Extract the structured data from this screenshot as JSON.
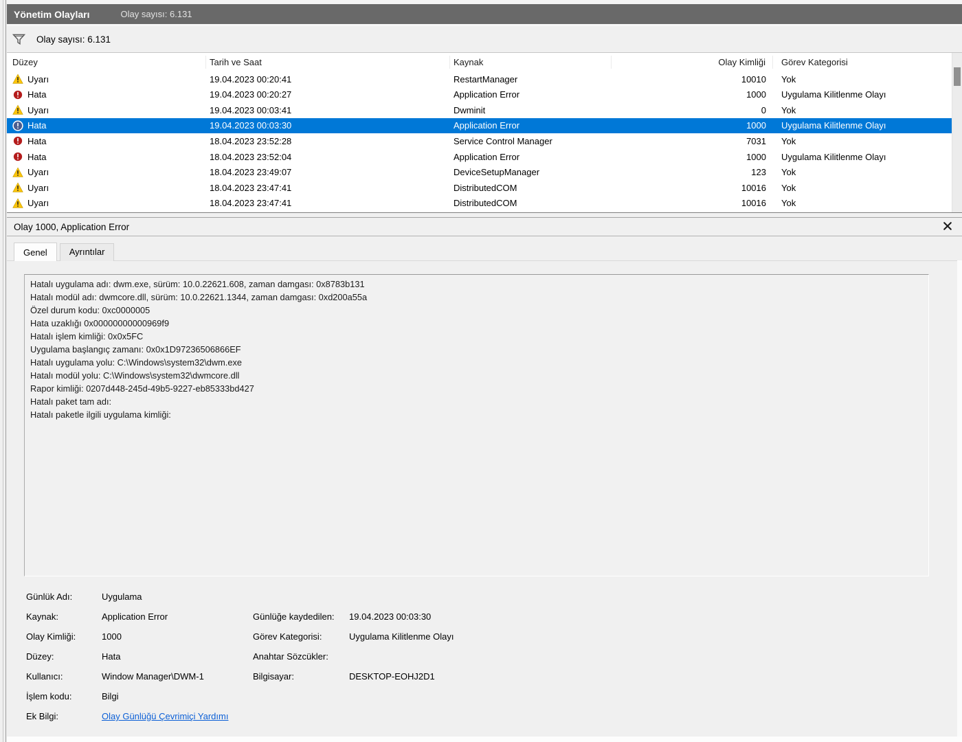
{
  "colors": {
    "accent": "#0078d7",
    "titlebar_bg": "#696969",
    "warning_icon": "#fdc50b",
    "error_icon": "#b41c1c",
    "selected_error_icon": "#4a5d8f",
    "link": "#0b5fd6"
  },
  "window": {
    "title": "Yönetim Olayları",
    "event_count": "Olay sayısı: 6.131"
  },
  "filter": {
    "icon": "filter-funnel-icon",
    "label": "Olay sayısı: 6.131"
  },
  "table": {
    "columns": {
      "level": "Düzey",
      "datetime": "Tarih ve Saat",
      "source": "Kaynak",
      "event_id": "Olay Kimliği",
      "category": "Görev Kategorisi"
    },
    "rows": [
      {
        "icon": "warning-icon",
        "level": "Uyarı",
        "datetime": "19.04.2023 00:20:41",
        "source": "RestartManager",
        "event_id": "10010",
        "category": "Yok",
        "selected": false
      },
      {
        "icon": "error-icon",
        "level": "Hata",
        "datetime": "19.04.2023 00:20:27",
        "source": "Application Error",
        "event_id": "1000",
        "category": "Uygulama Kilitlenme Olayı",
        "selected": false
      },
      {
        "icon": "warning-icon",
        "level": "Uyarı",
        "datetime": "19.04.2023 00:03:41",
        "source": "Dwminit",
        "event_id": "0",
        "category": "Yok",
        "selected": false
      },
      {
        "icon": "error-icon",
        "level": "Hata",
        "datetime": "19.04.2023 00:03:30",
        "source": "Application Error",
        "event_id": "1000",
        "category": "Uygulama Kilitlenme Olayı",
        "selected": true
      },
      {
        "icon": "error-icon",
        "level": "Hata",
        "datetime": "18.04.2023 23:52:28",
        "source": "Service Control Manager",
        "event_id": "7031",
        "category": "Yok",
        "selected": false
      },
      {
        "icon": "error-icon",
        "level": "Hata",
        "datetime": "18.04.2023 23:52:04",
        "source": "Application Error",
        "event_id": "1000",
        "category": "Uygulama Kilitlenme Olayı",
        "selected": false
      },
      {
        "icon": "warning-icon",
        "level": "Uyarı",
        "datetime": "18.04.2023 23:49:07",
        "source": "DeviceSetupManager",
        "event_id": "123",
        "category": "Yok",
        "selected": false
      },
      {
        "icon": "warning-icon",
        "level": "Uyarı",
        "datetime": "18.04.2023 23:47:41",
        "source": "DistributedCOM",
        "event_id": "10016",
        "category": "Yok",
        "selected": false
      },
      {
        "icon": "warning-icon",
        "level": "Uyarı",
        "datetime": "18.04.2023 23:47:41",
        "source": "DistributedCOM",
        "event_id": "10016",
        "category": "Yok",
        "selected": false
      }
    ]
  },
  "detail": {
    "title": "Olay 1000, Application Error",
    "close_icon": "close-icon",
    "tabs": [
      {
        "label": "Genel",
        "active": true
      },
      {
        "label": "Ayrıntılar",
        "active": false
      }
    ],
    "description_lines": [
      "Hatalı uygulama adı: dwm.exe, sürüm: 10.0.22621.608, zaman damgası: 0x8783b131",
      "Hatalı modül adı: dwmcore.dll, sürüm: 10.0.22621.1344, zaman damgası: 0xd200a55a",
      "Özel durum kodu: 0xc0000005",
      "Hata uzaklığı 0x00000000000969f9",
      "Hatalı işlem kimliği: 0x0x5FC",
      "Uygulama başlangıç zamanı: 0x0x1D97236506866EF",
      "Hatalı uygulama yolu: C:\\Windows\\system32\\dwm.exe",
      "Hatalı modül yolu: C:\\Windows\\system32\\dwmcore.dll",
      "Rapor kimliği: 0207d448-245d-49b5-9227-eb85333bd427",
      "Hatalı paket tam adı:",
      "Hatalı paketle ilgili uygulama kimliği:"
    ],
    "field_rows": [
      {
        "l_label": "Günlük Adı:",
        "l_value": "Uygulama",
        "r_label": "",
        "r_value": ""
      },
      {
        "l_label": "Kaynak:",
        "l_value": "Application Error",
        "r_label": "Günlüğe kaydedilen:",
        "r_value": "19.04.2023 00:03:30"
      },
      {
        "l_label": "Olay Kimliği:",
        "l_value": "1000",
        "r_label": "Görev Kategorisi:",
        "r_value": "Uygulama Kilitlenme Olayı"
      },
      {
        "l_label": "Düzey:",
        "l_value": "Hata",
        "r_label": "Anahtar Sözcükler:",
        "r_value": ""
      },
      {
        "l_label": "Kullanıcı:",
        "l_value": "Window Manager\\DWM-1",
        "r_label": "Bilgisayar:",
        "r_value": "DESKTOP-EOHJ2D1"
      },
      {
        "l_label": "İşlem kodu:",
        "l_value": "Bilgi",
        "r_label": "",
        "r_value": ""
      },
      {
        "l_label": "Ek Bilgi:",
        "l_value": "Olay Günlüğü Çevrimiçi Yardımı",
        "r_label": "",
        "r_value": "",
        "l_is_link": true
      }
    ]
  }
}
